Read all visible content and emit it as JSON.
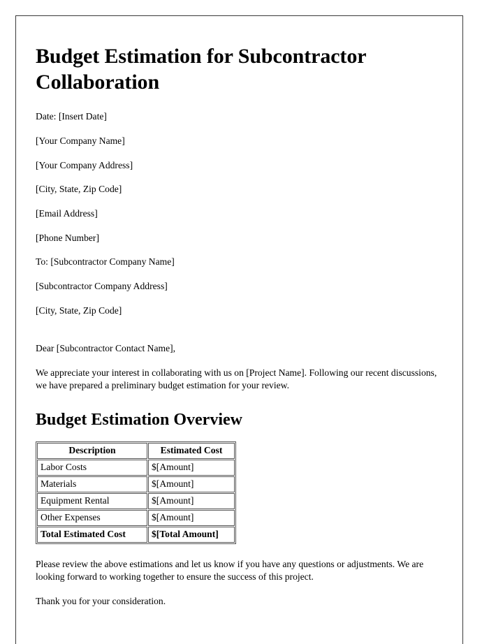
{
  "document": {
    "title": "Budget Estimation for Subcontractor Collaboration",
    "date_line": "Date: [Insert Date]",
    "sender": {
      "company_name": "[Your Company Name]",
      "company_address": "[Your Company Address]",
      "city_state_zip": "[City, State, Zip Code]",
      "email": "[Email Address]",
      "phone": "[Phone Number]"
    },
    "recipient": {
      "company_name": "To: [Subcontractor Company Name]",
      "company_address": "[Subcontractor Company Address]",
      "city_state_zip": "[City, State, Zip Code]"
    },
    "salutation": "Dear [Subcontractor Contact Name],",
    "intro_paragraph": "We appreciate your interest in collaborating with us on [Project Name]. Following our recent discussions, we have prepared a preliminary budget estimation for your review.",
    "section_heading": "Budget Estimation Overview",
    "closing_paragraph": "Please review the above estimations and let us know if you have any questions or adjustments. We are looking forward to working together to ensure the success of this project.",
    "thanks_paragraph": "Thank you for your consideration."
  },
  "budget_table": {
    "headers": [
      "Description",
      "Estimated Cost"
    ],
    "rows": [
      {
        "description": "Labor Costs",
        "cost": "$[Amount]"
      },
      {
        "description": "Materials",
        "cost": "$[Amount]"
      },
      {
        "description": "Equipment Rental",
        "cost": "$[Amount]"
      },
      {
        "description": "Other Expenses",
        "cost": "$[Amount]"
      }
    ],
    "total_row": {
      "description": "Total Estimated Cost",
      "cost": "$[Total Amount]"
    }
  }
}
